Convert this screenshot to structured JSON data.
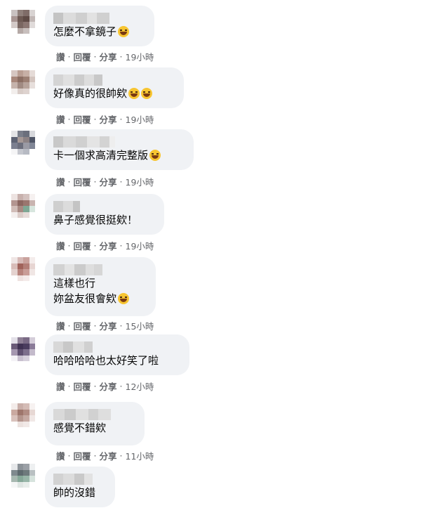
{
  "comments": [
    {
      "text_lines": [
        "怎麼不拿鏡子"
      ],
      "emojis": 1,
      "read": "讚",
      "reply": "回覆",
      "share": "分享",
      "time": "19小時"
    },
    {
      "text_lines": [
        "好像真的很帥欸"
      ],
      "emojis": 2,
      "read": "讚",
      "reply": "回覆",
      "share": "分享",
      "time": "19小時"
    },
    {
      "text_lines": [
        "卡一個求高清完整版"
      ],
      "emojis": 1,
      "read": "讚",
      "reply": "回覆",
      "share": "分享",
      "time": "19小時"
    },
    {
      "text_lines": [
        "鼻子感覺很挺欸！"
      ],
      "emojis": 0,
      "read": "讚",
      "reply": "回覆",
      "share": "分享",
      "time": "19小時"
    },
    {
      "text_lines": [
        "這樣也行",
        "妳盆友很會欸"
      ],
      "emojis": 1,
      "read": "讚",
      "reply": "回覆",
      "share": "分享",
      "time": "15小時"
    },
    {
      "text_lines": [
        "哈哈哈哈也太好笑了啦"
      ],
      "emojis": 0,
      "read": "讚",
      "reply": "回覆",
      "share": "分享",
      "time": "12小時"
    },
    {
      "text_lines": [
        "感覺不錯欸"
      ],
      "emojis": 0,
      "read": "讚",
      "reply": "回覆",
      "share": "分享",
      "time": "11小時"
    },
    {
      "text_lines": [
        "帥的沒錯"
      ],
      "emojis": 0
    }
  ],
  "separator": "·",
  "colors": {
    "bubble": "#f0f2f5",
    "text": "#050505",
    "meta": "#65676b"
  }
}
